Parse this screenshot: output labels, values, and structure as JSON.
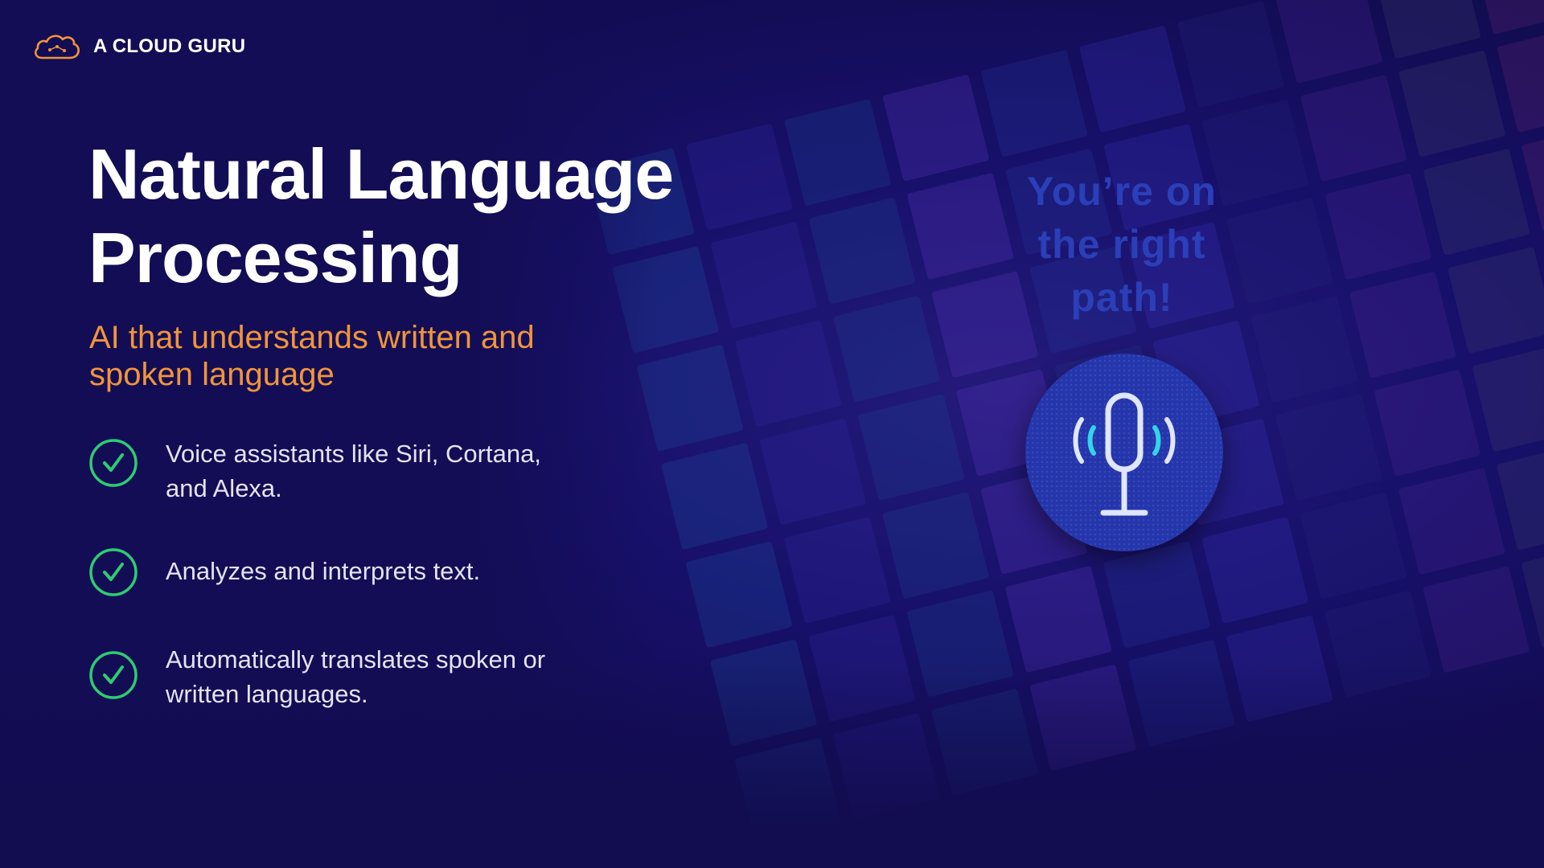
{
  "brand": {
    "name": "A CLOUD GURU",
    "logo_icon": "cloud-logo-icon",
    "accent_color": "#f0953a"
  },
  "slide": {
    "title_line1": "Natural Language",
    "title_line2": "Processing",
    "subtitle": "AI that understands written and spoken language",
    "bullets": [
      {
        "icon": "check-circle-icon",
        "text_line1": "Voice assistants like Siri, Cortana,",
        "text_line2": "and Alexa."
      },
      {
        "icon": "check-circle-icon",
        "text_line1": "Analyzes and interprets text.",
        "text_line2": ""
      },
      {
        "icon": "check-circle-icon",
        "text_line1": "Automatically translates spoken or",
        "text_line2": "written languages."
      }
    ]
  },
  "visual": {
    "tagline_line1": "You’re on",
    "tagline_line2": "the right",
    "tagline_line3": "path!",
    "mic_icon": "microphone-icon",
    "check_color": "#2ecc71",
    "badge_color": "#2536ad",
    "wave_color": "#35d3e8"
  }
}
